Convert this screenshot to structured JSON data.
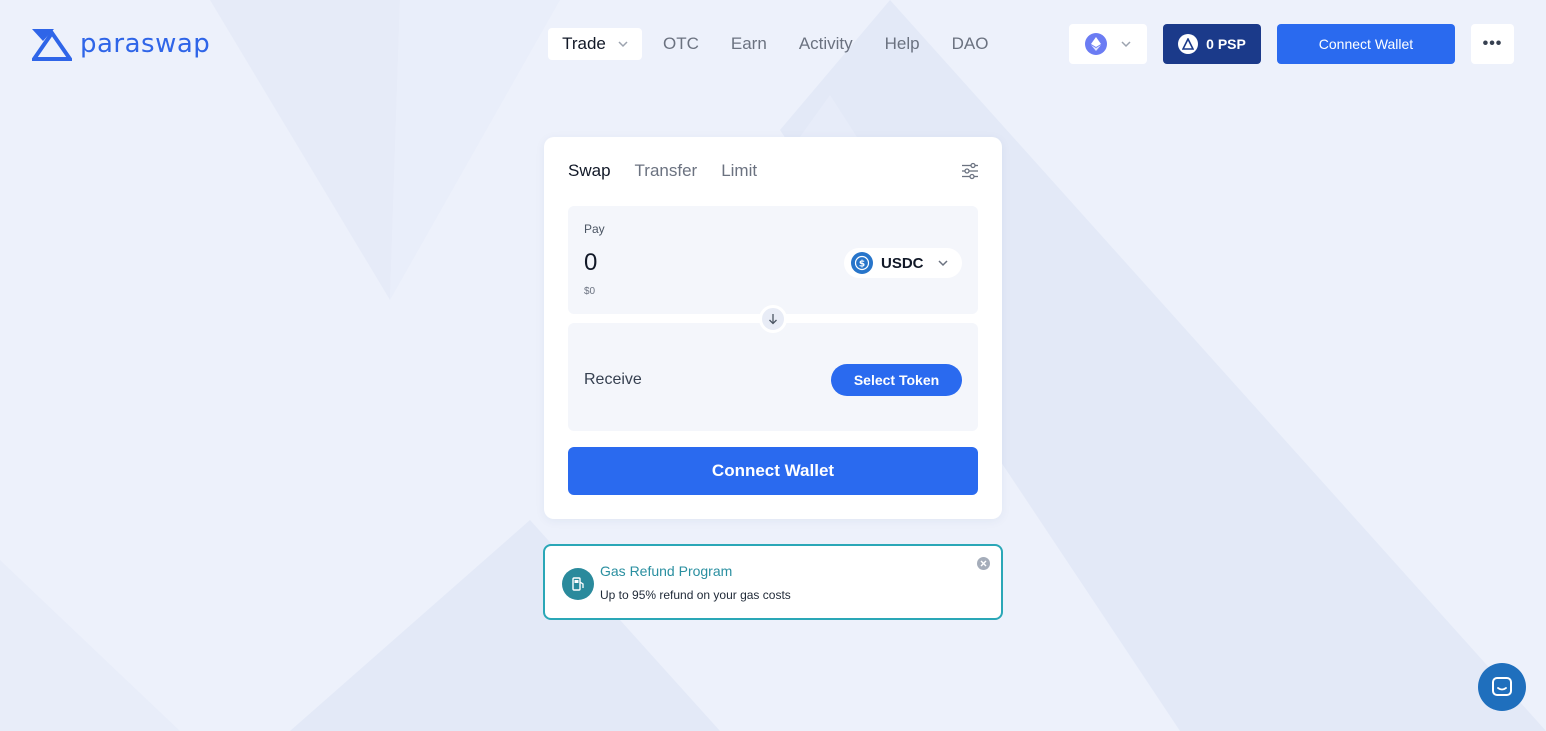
{
  "brand": {
    "name": "paraswap",
    "color": "#2f65e8"
  },
  "nav": {
    "trade_label": "Trade",
    "items": [
      "OTC",
      "Earn",
      "Activity",
      "Help",
      "DAO"
    ]
  },
  "header": {
    "network_icon": "ethereum-icon",
    "psp_label": "0 PSP",
    "connect_label": "Connect Wallet",
    "more_label": "•••"
  },
  "swap": {
    "tabs": [
      "Swap",
      "Transfer",
      "Limit"
    ],
    "active_tab": "Swap",
    "pay": {
      "label": "Pay",
      "amount": "0",
      "usd": "$0",
      "token": "USDC"
    },
    "receive": {
      "label": "Receive",
      "select_label": "Select Token"
    },
    "connect_label": "Connect Wallet"
  },
  "gas_refund": {
    "title": "Gas Refund Program",
    "subtitle": "Up to 95% refund on your gas costs"
  },
  "colors": {
    "primary": "#2a6aef",
    "psp_bg": "#1b3a8a",
    "gas_accent": "#2aa7b7",
    "background": "#edf1fb"
  }
}
